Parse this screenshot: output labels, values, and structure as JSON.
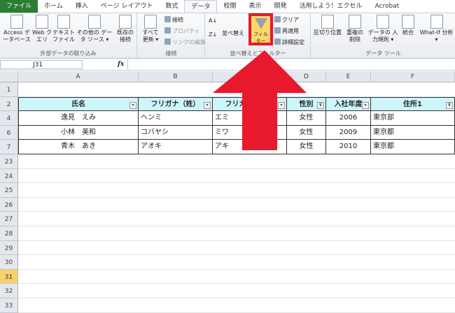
{
  "tabs": [
    "ファイル",
    "ホーム",
    "挿入",
    "ページ レイアウト",
    "数式",
    "データ",
    "校閲",
    "表示",
    "開発",
    "活用しよう！エクセル",
    "Acrobat"
  ],
  "ribbon": {
    "external": {
      "label": "外部データの取り込み",
      "buttons": [
        "Access データベース",
        "Web クエリ",
        "テキスト ファイル",
        "その他の データ ソース ▾",
        "既存の 接続"
      ]
    },
    "connections": {
      "label": "接続",
      "refresh": "すべて 更新 ▾",
      "items": [
        "接続",
        "プロパティ",
        "リンクの編集"
      ]
    },
    "sortfilter": {
      "label": "並べ替えとフィルター",
      "sort": "並べ替え",
      "filter": "フィルター",
      "items": [
        "クリア",
        "再適用",
        "詳細設定"
      ]
    },
    "datatools": {
      "label": "データ ツール",
      "buttons": [
        "区切り位置",
        "重複の 削除",
        "データの 入力規則 ▾",
        "統合",
        "What-If 分析 ▾"
      ]
    }
  },
  "formula": {
    "namebox": "J31",
    "fx": "fx",
    "value": ""
  },
  "columns": [
    "A",
    "B",
    "C",
    "D",
    "E",
    "F"
  ],
  "rows": [
    "1",
    "2",
    "4",
    "6",
    "7",
    "23",
    "24",
    "25",
    "26",
    "27",
    "28",
    "29",
    "30",
    "31",
    "32",
    "33"
  ],
  "table": {
    "headers": [
      "氏名",
      "フリガナ（姓）",
      "フリガナ（名）",
      "性別",
      "入社年度",
      "住所1"
    ],
    "data": [
      [
        "逸見　えみ",
        "ヘンミ",
        "エミ",
        "女性",
        "2006",
        "東京部"
      ],
      [
        "小林　美和",
        "コバヤシ",
        "ミワ",
        "女性",
        "2009",
        "東京都"
      ],
      [
        "青木　あき",
        "アオキ",
        "アキ",
        "女性",
        "2010",
        "東京都"
      ]
    ]
  },
  "colors": {
    "header_fill": "#cdf6fb",
    "arrow": "#e8192c",
    "selected_row": "#f7d26a",
    "file_tab": "#2a7d33"
  }
}
